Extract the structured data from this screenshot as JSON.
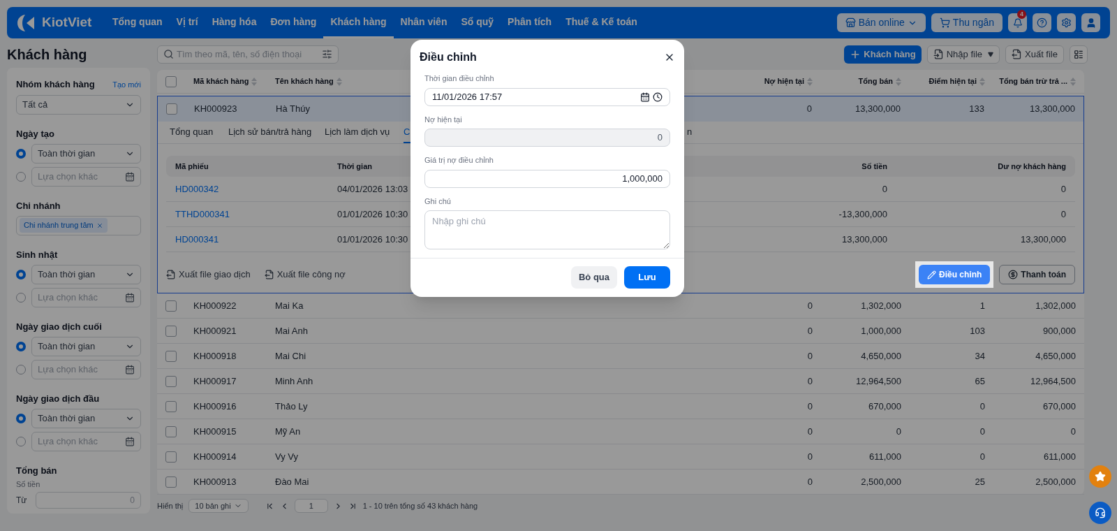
{
  "nav": {
    "logo": "KiotViet",
    "items": [
      {
        "label": "Tổng quan",
        "selected": false
      },
      {
        "label": "Vị trí",
        "selected": false
      },
      {
        "label": "Hàng hóa",
        "selected": false
      },
      {
        "label": "Đơn hàng",
        "selected": false
      },
      {
        "label": "Khách hàng",
        "selected": true
      },
      {
        "label": "Nhân viên",
        "selected": false
      },
      {
        "label": "Sổ quỹ",
        "selected": false
      },
      {
        "label": "Phân tích",
        "selected": false
      },
      {
        "label": "Thuế & Kế toán",
        "selected": false
      }
    ],
    "online_button": "Bán online",
    "cashier_button": "Thu ngân",
    "notification_count": "4"
  },
  "page_title": "Khách hàng",
  "filters": [
    {
      "kind": "select",
      "title": "Nhóm khách hàng",
      "link": "Tạo mới",
      "value": "Tất cả"
    },
    {
      "kind": "choice",
      "title": "Ngày tạo",
      "options": [
        {
          "kind": "select",
          "selected": true,
          "value": "Toàn thời gian"
        },
        {
          "kind": "date",
          "selected": false,
          "placeholder": "Lựa chọn khác"
        }
      ]
    },
    {
      "kind": "tags",
      "title": "Chi nhánh",
      "tags": [
        "Chi nhánh trung tâm"
      ]
    },
    {
      "kind": "choice",
      "title": "Sinh nhật",
      "options": [
        {
          "kind": "select",
          "selected": true,
          "value": "Toàn thời gian"
        },
        {
          "kind": "date",
          "selected": false,
          "placeholder": "Lựa chọn khác"
        }
      ]
    },
    {
      "kind": "choice",
      "title": "Ngày giao dịch cuối",
      "options": [
        {
          "kind": "select",
          "selected": true,
          "value": "Toàn thời gian"
        },
        {
          "kind": "date",
          "selected": false,
          "placeholder": "Lựa chọn khác"
        }
      ]
    },
    {
      "kind": "choice",
      "title": "Ngày giao dịch đầu",
      "options": [
        {
          "kind": "select",
          "selected": true,
          "value": "Toàn thời gian"
        },
        {
          "kind": "date",
          "selected": false,
          "placeholder": "Lựa chọn khác"
        }
      ]
    },
    {
      "kind": "range",
      "title": "Tổng bán",
      "subtitle": "Số tiền",
      "from_label": "Từ",
      "from_placeholder": "0"
    }
  ],
  "search": {
    "placeholder": "Tìm theo mã, tên, số điện thoại"
  },
  "actions": [
    {
      "kind": "add",
      "label": "Khách hàng"
    },
    {
      "kind": "import",
      "label": "Nhập file"
    },
    {
      "kind": "export",
      "label": "Xuất file"
    }
  ],
  "table": {
    "select_all_checked": false,
    "columns": [
      "Mã khách hàng",
      "Tên khách hàng",
      "Nợ hiện tại",
      "Tổng bán",
      "Điểm hiện tại",
      "Tổng bán trừ trả ..."
    ],
    "rows": [
      {
        "code": "KH000923",
        "name": "Hà Thúy",
        "debt": "0",
        "total": "13,300,000",
        "points": "133",
        "net": "13,300,000",
        "checked": false,
        "expanded": true
      },
      {
        "code": "KH000922",
        "name": "Mai Ka",
        "debt": "0",
        "total": "1,302,000",
        "points": "1",
        "net": "1,302,000",
        "checked": false,
        "expanded": false
      },
      {
        "code": "KH000921",
        "name": "Mai Anh",
        "debt": "0",
        "total": "1,000,000",
        "points": "103",
        "net": "900,000",
        "checked": false,
        "expanded": false
      },
      {
        "code": "KH000918",
        "name": "Mai Chi",
        "debt": "0",
        "total": "4,650,000",
        "points": "34",
        "net": "4,650,000",
        "checked": false,
        "expanded": false
      },
      {
        "code": "KH000917",
        "name": "Minh Anh",
        "debt": "0",
        "total": "12,964,500",
        "points": "65",
        "net": "12,964,500",
        "checked": false,
        "expanded": false
      },
      {
        "code": "KH000916",
        "name": "Thảo Ly",
        "debt": "0",
        "total": "670,000",
        "points": "0",
        "net": "670,000",
        "checked": false,
        "expanded": false
      },
      {
        "code": "KH000915",
        "name": "Mỹ An",
        "debt": "0",
        "total": "0",
        "points": "0",
        "net": "0",
        "checked": false,
        "expanded": false
      },
      {
        "code": "KH000914",
        "name": "Vy Vy",
        "debt": "0",
        "total": "611,000",
        "points": "0",
        "net": "611,000",
        "checked": false,
        "expanded": false
      },
      {
        "code": "KH000913",
        "name": "Đào Mai",
        "debt": "0",
        "total": "2,500,000",
        "points": "25",
        "net": "2,500,000",
        "checked": false,
        "expanded": false
      }
    ]
  },
  "detail": {
    "tabs": [
      {
        "label": "Tổng quan",
        "selected": false
      },
      {
        "label": "Lịch sử bán/trả hàng",
        "selected": false
      },
      {
        "label": "Lịch làm dịch vụ",
        "selected": false
      },
      {
        "label": "C",
        "selected": true
      },
      {
        "label": "n",
        "selected": false
      }
    ],
    "columns": [
      "Mã phiếu",
      "Thời gian",
      "Số tiền",
      "Dư nợ khách hàng"
    ],
    "rows": [
      {
        "code": "HD000342",
        "time": "04/01/2026 13:03",
        "amount": "0",
        "balance": "0"
      },
      {
        "code": "TTHD000341",
        "time": "01/01/2026 10:30",
        "amount": "-13,300,000",
        "balance": "0"
      },
      {
        "code": "HD000341",
        "time": "01/01/2026 10:30",
        "amount": "13,300,000",
        "balance": "13,300,000"
      }
    ],
    "export_links": [
      "Xuất file giao dịch",
      "Xuất file công nợ"
    ],
    "buttons": [
      {
        "kind": "adjust",
        "label": "Điều chỉnh",
        "highlighted": true
      },
      {
        "kind": "pay",
        "label": "Thanh toán",
        "highlighted": false
      }
    ]
  },
  "pagination": {
    "label": "Hiển thị",
    "page_size": "10 bản ghi",
    "page": "1",
    "summary": "1 - 10 trên tổng số 43 khách hàng"
  },
  "modal": {
    "title": "Điều chỉnh",
    "fields": [
      {
        "kind": "datetime",
        "label": "Thời gian điều chỉnh",
        "value": "11/01/2026 17:57"
      },
      {
        "kind": "readonly",
        "label": "Nợ hiện tại",
        "value": "0"
      },
      {
        "kind": "number",
        "label": "Giá trị nợ điều chỉnh",
        "value": "1,000,000"
      },
      {
        "kind": "textarea",
        "label": "Ghi chú",
        "placeholder": "Nhập ghi chú"
      }
    ],
    "buttons": [
      {
        "kind": "secondary",
        "label": "Bỏ qua"
      },
      {
        "kind": "primary",
        "label": "Lưu"
      }
    ]
  }
}
